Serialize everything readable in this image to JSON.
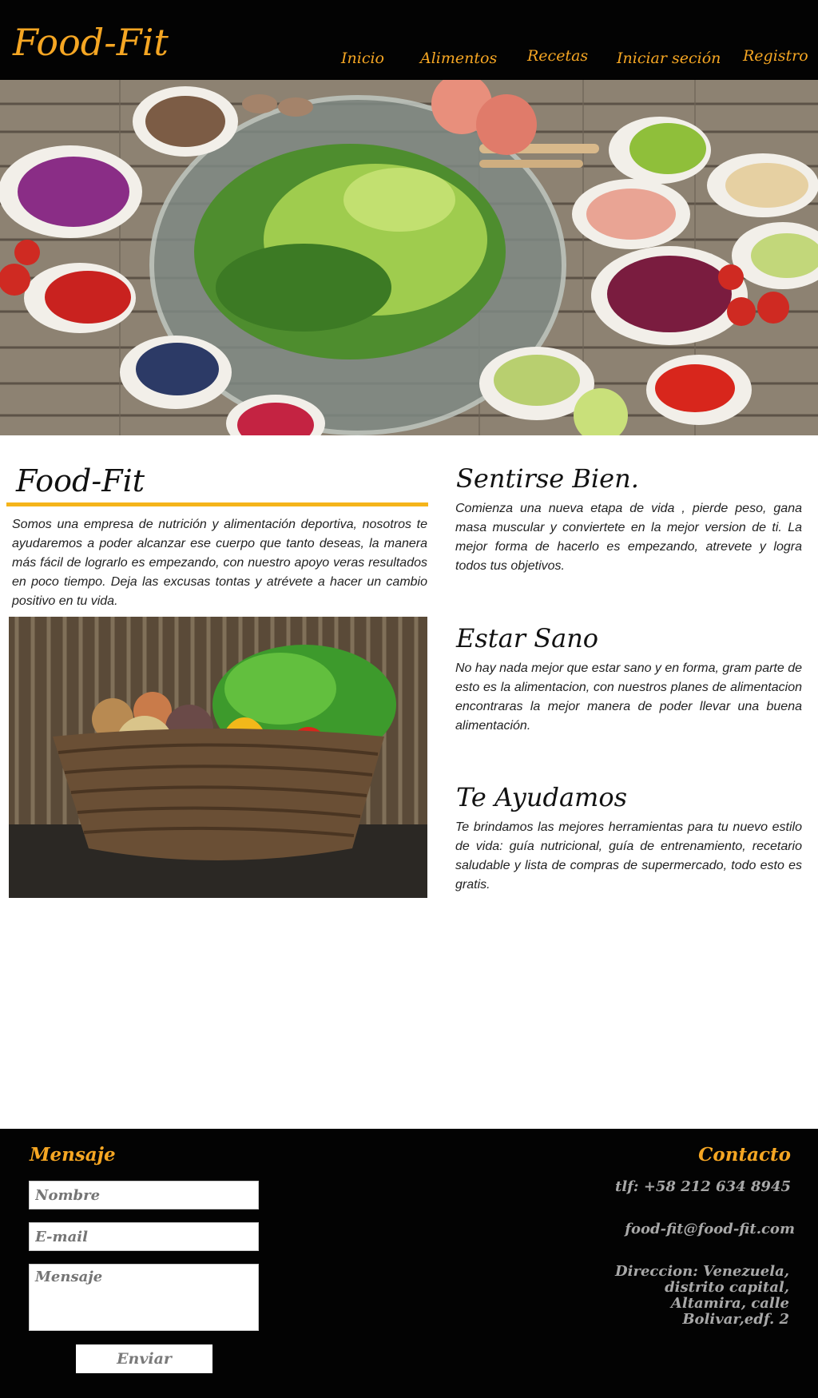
{
  "header": {
    "logo": "Food-Fit",
    "nav": [
      "Inicio",
      "Alimentos",
      "Recetas",
      "Iniciar seción",
      "Registro"
    ]
  },
  "hero": {
    "image": "salad-table-photo"
  },
  "intro": {
    "title": "Food-Fit",
    "text": "Somos una empresa de nutrición y alimentación deportiva, nosotros te ayudaremos  a poder alcanzar ese cuerpo que tanto deseas, la manera más fácil de lograrlo es empezando, con nuestro apoyo veras resultados en poco tiempo. Deja  las excusas tontas y atrévete a hacer un cambio positivo en tu vida.",
    "image": "vegetable-basket-photo"
  },
  "sections": [
    {
      "title": "Sentirse Bien.",
      "text": "Comienza una nueva etapa de vida , pierde peso, gana masa muscular y conviertete en la mejor version de ti. La mejor forma de hacerlo es empezando, atrevete y logra todos tus objetivos."
    },
    {
      "title": "Estar Sano",
      "text": "No hay nada mejor que estar sano y en forma, gram parte de esto es la alimentacion, con nuestros planes de alimentacion encontraras la mejor manera de poder llevar una buena alimentación."
    },
    {
      "title": "Te Ayudamos",
      "text": "Te brindamos las mejores herramientas para tu nuevo estilo de vida: guía nutricional, guía de entrenamiento, recetario saludable y lista de compras de supermercado, todo esto es gratis."
    }
  ],
  "footer": {
    "message_title": "Mensaje",
    "name_placeholder": "Nombre",
    "email_placeholder": "E-mail",
    "message_placeholder": "Mensaje",
    "send_label": "Enviar",
    "contact_title": "Contacto",
    "phone": "tlf: +58 212 634 8945",
    "email": "food-fit@food-fit.com",
    "address": "Direccion: Venezuela, distrito capital, Altamira, calle Bolivar,edf. 2"
  },
  "colors": {
    "accent": "#f5a623",
    "header_bg": "#030303",
    "underline": "#f5b41a"
  }
}
